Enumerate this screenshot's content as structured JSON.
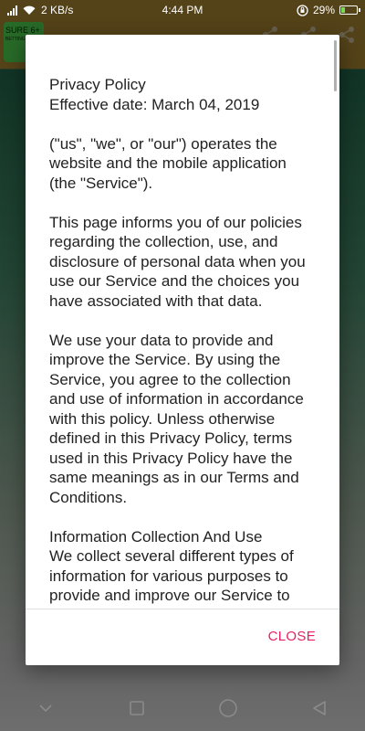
{
  "statusbar": {
    "network_speed": "2 KB/s",
    "time": "4:44 PM",
    "battery_percent": "29%",
    "battery_level": 0.29
  },
  "app": {
    "logo_text": "SURE 6+",
    "logo_subtext": "BETTING"
  },
  "dialog": {
    "paragraphs": [
      "Privacy Policy\nEffective date: March 04, 2019",
      "(\"us\", \"we\", or \"our\") operates the website and the mobile application (the \"Service\").",
      "This page informs you of our policies regarding the collection, use, and disclosure of personal data when you use our Service and the choices you have associated with that data.",
      "We use your data to provide and improve the Service. By using the Service, you agree to the collection and use of information in accordance with this policy. Unless otherwise defined in this Privacy Policy, terms used in this Privacy Policy have the same meanings as in our Terms and Conditions.",
      "Information Collection And Use\nWe collect several different types of information for various purposes to provide and improve our Service to you."
    ],
    "close_label": "CLOSE",
    "accent_color": "#e91e63"
  },
  "icons": {
    "status_left": [
      "notification-icon",
      "wifi-icon"
    ],
    "status_right": [
      "rotation-lock-icon",
      "battery-icon"
    ],
    "appbar": [
      "share-icon",
      "share-icon",
      "share-icon"
    ],
    "navbar": [
      "down-chevron-icon",
      "square-icon",
      "circle-icon",
      "triangle-back-icon"
    ]
  }
}
